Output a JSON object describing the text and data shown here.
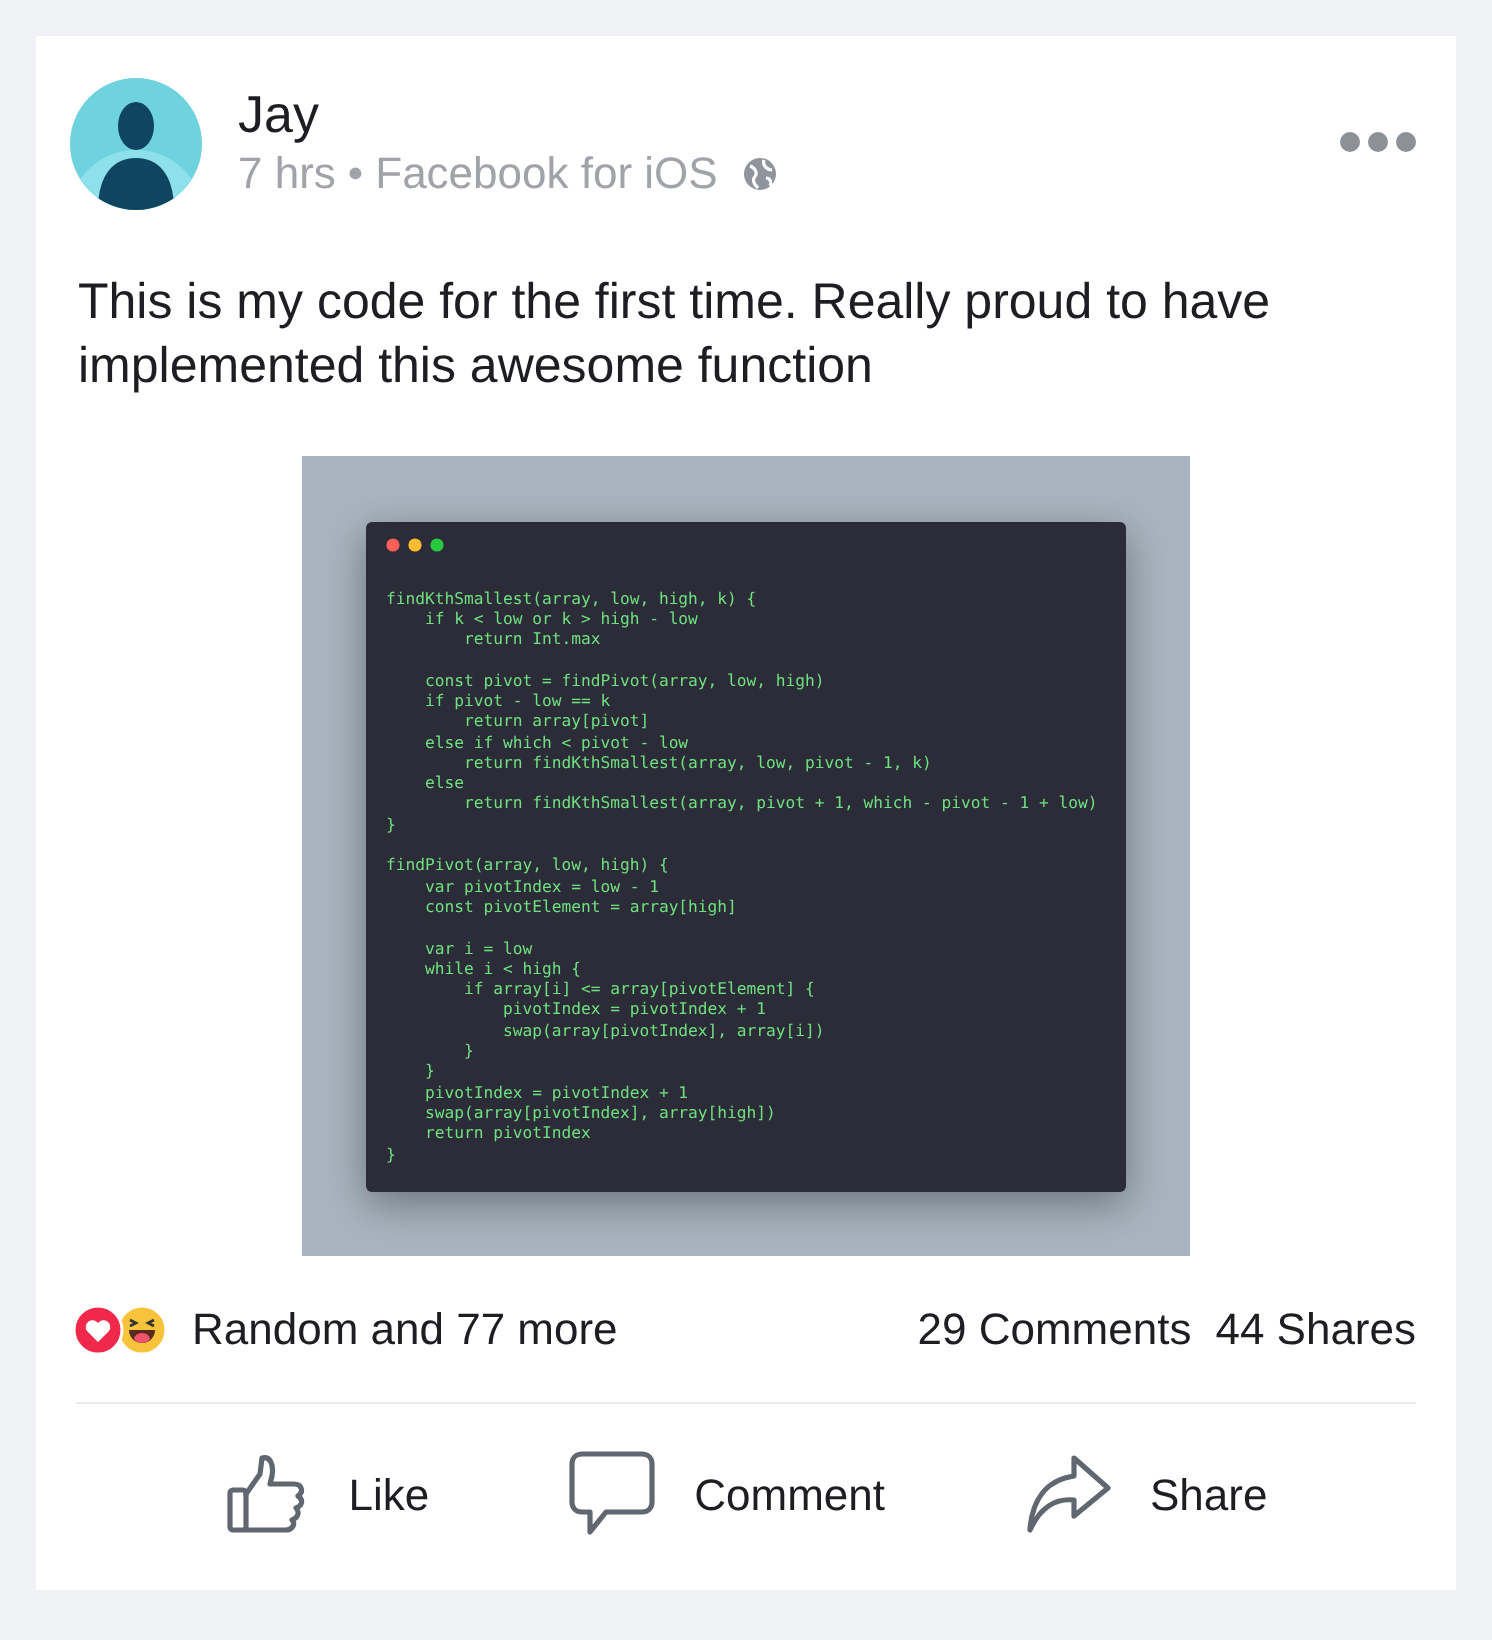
{
  "post": {
    "author": "Jay",
    "time": "7 hrs",
    "separator": "•",
    "source": "Facebook for iOS",
    "text": "This is my code for the first time. Really proud to have implemented this awesome function",
    "code_window": {
      "blocks": [
        [
          "findKthSmallest(array, low, high, k) {",
          "    if k < low or k > high - low",
          "        return Int.max"
        ],
        [
          "    const pivot = findPivot(array, low, high)",
          "    if pivot - low == k",
          "        return array[pivot]",
          "    else if which < pivot - low",
          "        return findKthSmallest(array, low, pivot - 1, k)",
          "    else",
          "        return findKthSmallest(array, pivot + 1, which - pivot - 1 + low)",
          "}"
        ],
        [
          "findPivot(array, low, high) {",
          "    var pivotIndex = low - 1",
          "    const pivotElement = array[high]"
        ],
        [
          "    var i = low",
          "    while i < high {",
          "        if array[i] <= array[pivotElement] {",
          "            pivotIndex = pivotIndex + 1",
          "            swap(array[pivotIndex], array[i])",
          "        }",
          "    }",
          "    pivotIndex = pivotIndex + 1",
          "    swap(array[pivotIndex], array[high])",
          "    return pivotIndex",
          "}"
        ]
      ]
    },
    "reactions": [
      {
        "kind": "love"
      },
      {
        "kind": "haha"
      }
    ],
    "reaction_summary": "Random and 77 more",
    "comments": "29 Comments",
    "shares": "44 Shares",
    "actions": [
      {
        "kind": "like",
        "label": "Like"
      },
      {
        "kind": "comment",
        "label": "Comment"
      },
      {
        "kind": "share",
        "label": "Share"
      }
    ]
  }
}
